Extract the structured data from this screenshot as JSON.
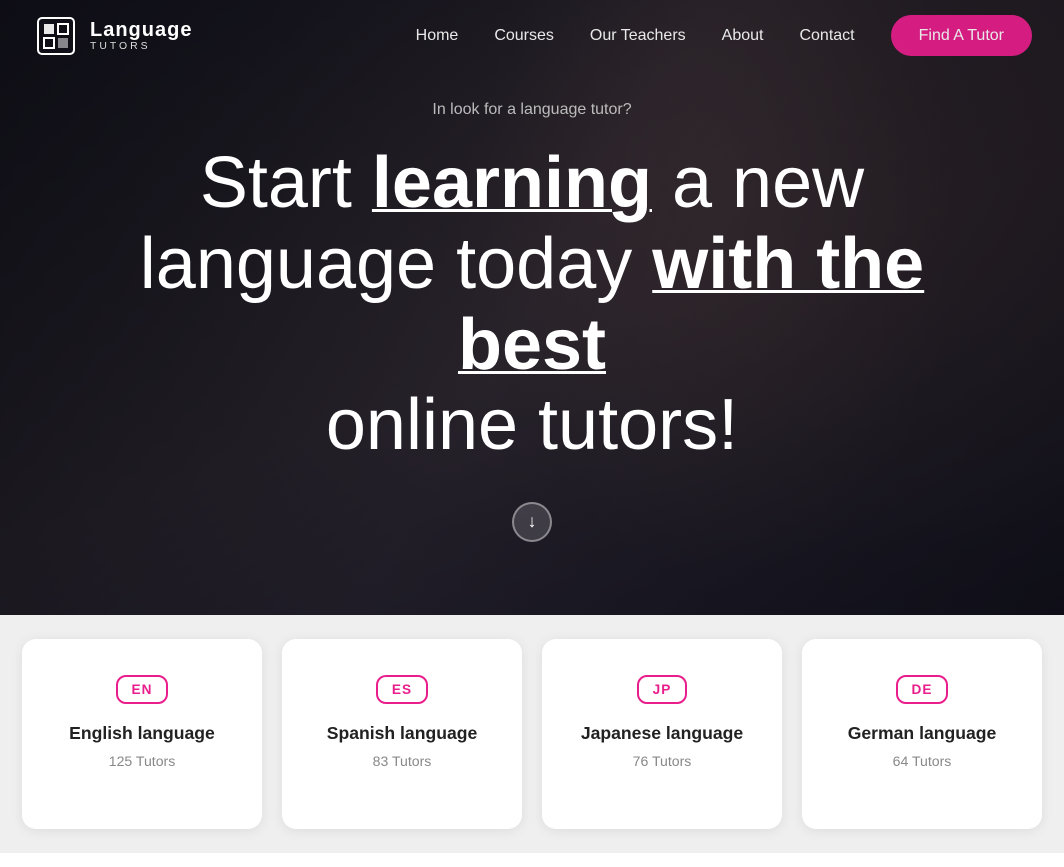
{
  "brand": {
    "name": "Language",
    "sub": "TUTORS",
    "logo_alt": "Language Tutors Logo"
  },
  "nav": {
    "links": [
      {
        "label": "Home",
        "href": "#"
      },
      {
        "label": "Courses",
        "href": "#"
      },
      {
        "label": "Our Teachers",
        "href": "#"
      },
      {
        "label": "About",
        "href": "#"
      },
      {
        "label": "Contact",
        "href": "#"
      }
    ],
    "cta_label": "Find A Tutor"
  },
  "hero": {
    "subtitle": "In look for a language tutor?",
    "headline_part1": "Start ",
    "headline_learning": "learning",
    "headline_part2": " a new language today ",
    "headline_best": "with the best",
    "headline_part3": " online tutors!",
    "scroll_icon": "↓"
  },
  "languages": [
    {
      "code": "EN",
      "name": "English language",
      "tutors": "125 Tutors"
    },
    {
      "code": "ES",
      "name": "Spanish language",
      "tutors": "83 Tutors"
    },
    {
      "code": "JP",
      "name": "Japanese language",
      "tutors": "76 Tutors"
    },
    {
      "code": "DE",
      "name": "German language",
      "tutors": "64 Tutors"
    }
  ]
}
